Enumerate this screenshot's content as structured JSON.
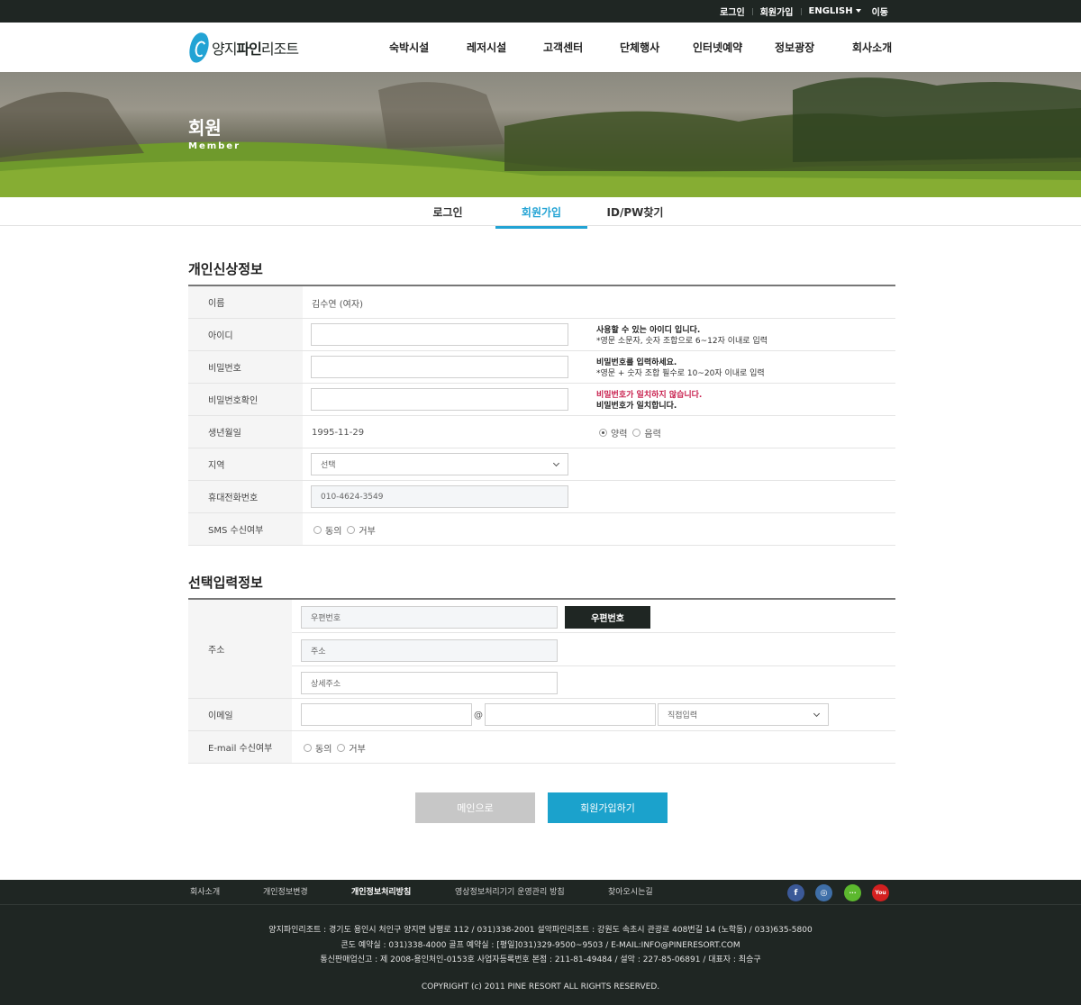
{
  "topbar": {
    "login": "로그인",
    "join": "회원가입",
    "english": "ENGLISH",
    "move": "이동"
  },
  "header": {
    "logo_prefix": "양지",
    "logo_bold": "파인",
    "logo_suffix": "리조트",
    "nav": [
      "숙박시설",
      "레저시설",
      "고객센터",
      "단체행사",
      "인터넷예약",
      "정보광장",
      "회사소개"
    ]
  },
  "hero": {
    "title": "회원",
    "subtitle": "Member"
  },
  "tabs": [
    "로그인",
    "회원가입",
    "ID/PW찾기"
  ],
  "personal": {
    "title": "개인신상정보",
    "name_label": "이름",
    "name_value": "김수연 (여자)",
    "id_label": "아이디",
    "id_hint_bold": "사용할 수 있는 아이디 입니다.",
    "id_hint": "*영문 소문자, 숫자 조합으로 6~12자 이내로 입력",
    "pw_label": "비밀번호",
    "pw_hint_bold": "비밀번호를 입력하세요.",
    "pw_hint": "*영문 + 숫자 조합 필수로 10~20자 이내로 입력",
    "pwc_label": "비밀번호확인",
    "pwc_hint_red": "비밀번호가 일치하지 않습니다.",
    "pwc_hint_ok": "비밀번호가 일치합니다.",
    "birth_label": "생년월일",
    "birth_value": "1995-11-29",
    "solar": "양력",
    "lunar": "음력",
    "region_label": "지역",
    "region_value": "선택",
    "phone_label": "휴대전화번호",
    "phone_value": "010-4624-3549",
    "sms_label": "SMS 수신여부",
    "agree": "동의",
    "deny": "거부"
  },
  "optional": {
    "title": "선택입력정보",
    "addr_label": "주소",
    "zip_placeholder": "우편번호",
    "zip_button": "우편번호",
    "addr_placeholder": "주소",
    "detail_placeholder": "상세주소",
    "email_label": "이메일",
    "at": "@",
    "email_select": "직접입력",
    "email_recv_label": "E-mail 수신여부",
    "agree": "동의",
    "deny": "거부"
  },
  "buttons": {
    "main": "메인으로",
    "join": "회원가입하기"
  },
  "footer": {
    "nav": [
      "회사소개",
      "개인정보변경",
      "개인정보처리방침",
      "영상정보처리기기 운영관리 방침",
      "찾아오시는길"
    ],
    "sns": [
      "facebook-icon",
      "instagram-icon",
      "talk-icon",
      "youtube-icon"
    ],
    "sns_labels": [
      "f",
      "◎",
      "···",
      "You"
    ],
    "line1": "양지파인리조트 : 경기도 용인시 처인구 양지면 남평로 112 / 031)338-2001    설악파인리조트 : 강원도 속초시 관광로 408번길 14 (노학동) / 033)635-5800",
    "line2": "콘도 예약실 : 031)338-4000    골프 예약실 : [평일]031)329-9500~9503 / E-MAIL:INFO@PINERESORT.COM",
    "line3": "통신판매업신고 : 제 2008-용인처인-0153호    사업자등록번호 본점 : 211-81-49484 / 설악 : 227-85-06891 / 대표자 : 최승구",
    "copyright": "COPYRIGHT (c) 2011 PINE RESORT ALL RIGHTS RESERVED."
  },
  "colors": {
    "accent": "#22a3d4",
    "dark": "#1f2623",
    "error": "#c8204e"
  }
}
